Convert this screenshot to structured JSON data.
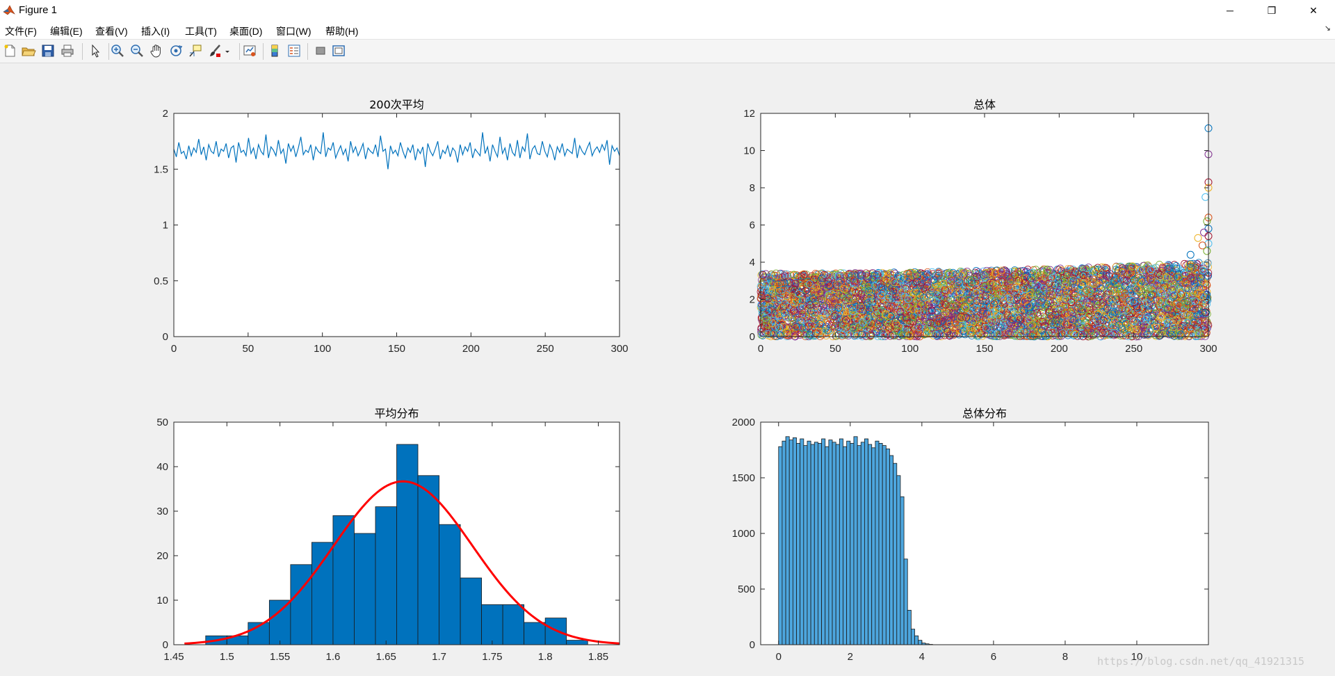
{
  "window": {
    "title": "Figure 1",
    "controls": {
      "minimize": "─",
      "restore": "❐",
      "close": "✕"
    }
  },
  "menu": {
    "items": [
      "文件(F)",
      "编辑(E)",
      "查看(V)",
      "插入(I)",
      "工具(T)",
      "桌面(D)",
      "窗口(W)",
      "帮助(H)"
    ],
    "dock_arrow": "↘"
  },
  "toolbar": {
    "icons": [
      "new-figure-icon",
      "open-file-icon",
      "save-icon",
      "print-icon",
      "select-arrow-icon",
      "zoom-in-icon",
      "zoom-out-icon",
      "pan-hand-icon",
      "rotate-3d-icon",
      "data-cursor-icon",
      "brush-icon",
      "brush-dropdown-icon",
      "link-plot-icon",
      "colorbar-icon",
      "legend-icon",
      "hide-plot-tools-icon",
      "show-plot-tools-icon"
    ]
  },
  "watermark": "https://blog.csdn.net/qq_41921315",
  "chart_data": [
    {
      "type": "line",
      "title": "200次平均",
      "xlim": [
        0,
        300
      ],
      "ylim": [
        0,
        2
      ],
      "xticks": [
        "0",
        "50",
        "100",
        "150",
        "200",
        "250",
        "300"
      ],
      "yticks": [
        "0",
        "0.5",
        "1",
        "1.5",
        "2"
      ],
      "color": "#0072bd",
      "series": [
        {
          "y": [
            1.68,
            1.61,
            1.74,
            1.64,
            1.66,
            1.59,
            1.71,
            1.62,
            1.69,
            1.65,
            1.77,
            1.63,
            1.7,
            1.58,
            1.72,
            1.66,
            1.64,
            1.75,
            1.61,
            1.68,
            1.66,
            1.73,
            1.6,
            1.69,
            1.71,
            1.56,
            1.74,
            1.65,
            1.67,
            1.62,
            1.78,
            1.64,
            1.69,
            1.59,
            1.72,
            1.66,
            1.63,
            1.81,
            1.6,
            1.7,
            1.67,
            1.62,
            1.76,
            1.64,
            1.68,
            1.55,
            1.73,
            1.66,
            1.71,
            1.61,
            1.69,
            1.79,
            1.63,
            1.67,
            1.65,
            1.72,
            1.58,
            1.7,
            1.66,
            1.64,
            1.83,
            1.61,
            1.69,
            1.67,
            1.74,
            1.6,
            1.66,
            1.71,
            1.63,
            1.68,
            1.57,
            1.75,
            1.65,
            1.7,
            1.62,
            1.67,
            1.73,
            1.59,
            1.69,
            1.66,
            1.64,
            1.72,
            1.61,
            1.8,
            1.66,
            1.68,
            1.5,
            1.71,
            1.64,
            1.67,
            1.62,
            1.74,
            1.66,
            1.6,
            1.69,
            1.65,
            1.72,
            1.58,
            1.68,
            1.64,
            1.7,
            1.52,
            1.73,
            1.66,
            1.62,
            1.68,
            1.75,
            1.59,
            1.67,
            1.64,
            1.71,
            1.61,
            1.69,
            1.66,
            1.56,
            1.72,
            1.63,
            1.7,
            1.66,
            1.74,
            1.6,
            1.68,
            1.65,
            1.62,
            1.83,
            1.64,
            1.7,
            1.57,
            1.72,
            1.66,
            1.61,
            1.79,
            1.64,
            1.69,
            1.58,
            1.73,
            1.65,
            1.62,
            1.76,
            1.6,
            1.7,
            1.66,
            1.82,
            1.59,
            1.68,
            1.71,
            1.64,
            1.63,
            1.75,
            1.66,
            1.61,
            1.72,
            1.67,
            1.58,
            1.7,
            1.65,
            1.73,
            1.62,
            1.68,
            1.66,
            1.64,
            1.78,
            1.6,
            1.71,
            1.66,
            1.63,
            1.69,
            1.74,
            1.62,
            1.67,
            1.7,
            1.65,
            1.72,
            1.67,
            1.76,
            1.54,
            1.71,
            1.66,
            1.69,
            1.62
          ]
        }
      ]
    },
    {
      "type": "scatter",
      "title": "总体",
      "xlim": [
        0,
        300
      ],
      "ylim": [
        0,
        12
      ],
      "xticks": [
        "0",
        "50",
        "100",
        "150",
        "200",
        "250",
        "300"
      ],
      "yticks": [
        "0",
        "2",
        "4",
        "6",
        "8",
        "10",
        "12"
      ],
      "colors": [
        "#0072bd",
        "#d95319",
        "#edb120",
        "#7e2f8e",
        "#77ac30",
        "#4dbeee",
        "#a2142f"
      ],
      "outliers": [
        [
          300,
          11.2
        ],
        [
          300,
          9.8
        ],
        [
          300,
          8.3
        ],
        [
          300,
          8.0
        ],
        [
          298,
          7.5
        ],
        [
          300,
          6.4
        ],
        [
          299,
          6.2
        ],
        [
          300,
          5.8
        ],
        [
          297,
          5.6
        ],
        [
          300,
          5.4
        ],
        [
          293,
          5.3
        ],
        [
          300,
          5.0
        ],
        [
          296,
          4.9
        ],
        [
          299,
          4.6
        ],
        [
          288,
          4.4
        ]
      ]
    },
    {
      "type": "bar",
      "title": "平均分布",
      "xlim": [
        1.45,
        1.87
      ],
      "ylim": [
        0,
        50
      ],
      "xticks": [
        "1.45",
        "1.5",
        "1.55",
        "1.6",
        "1.65",
        "1.7",
        "1.75",
        "1.8",
        "1.85"
      ],
      "yticks": [
        "0",
        "10",
        "20",
        "30",
        "40",
        "50"
      ],
      "bin_edges": [
        1.48,
        1.5,
        1.52,
        1.54,
        1.56,
        1.58,
        1.6,
        1.62,
        1.64,
        1.66,
        1.68,
        1.7,
        1.72,
        1.74,
        1.76,
        1.78,
        1.8,
        1.82,
        1.84,
        1.86
      ],
      "values": [
        2,
        2,
        5,
        10,
        18,
        23,
        29,
        25,
        31,
        45,
        38,
        27,
        15,
        9,
        9,
        5,
        6,
        1,
        0
      ],
      "bar_color": "#0072bd",
      "fit_curve": {
        "type": "normal",
        "mean": 1.666,
        "std": 0.0653,
        "peak": 36.7,
        "range": [
          1.46,
          1.87
        ],
        "color": "#ff0000"
      }
    },
    {
      "type": "bar",
      "title": "总体分布",
      "xlim": [
        -0.5,
        12
      ],
      "ylim": [
        0,
        2000
      ],
      "xticks": [
        "0",
        "2",
        "4",
        "6",
        "8",
        "10"
      ],
      "yticks": [
        "0",
        "500",
        "1000",
        "1500",
        "2000"
      ],
      "bin_start": 0.0,
      "bin_width": 0.1,
      "values": [
        1780,
        1830,
        1870,
        1840,
        1860,
        1810,
        1850,
        1790,
        1830,
        1800,
        1820,
        1810,
        1850,
        1780,
        1840,
        1820,
        1800,
        1850,
        1780,
        1830,
        1810,
        1870,
        1790,
        1820,
        1850,
        1800,
        1770,
        1830,
        1810,
        1790,
        1760,
        1700,
        1630,
        1520,
        1330,
        770,
        310,
        140,
        80,
        40,
        15,
        8,
        3
      ],
      "bar_color": "#4da6de"
    }
  ]
}
